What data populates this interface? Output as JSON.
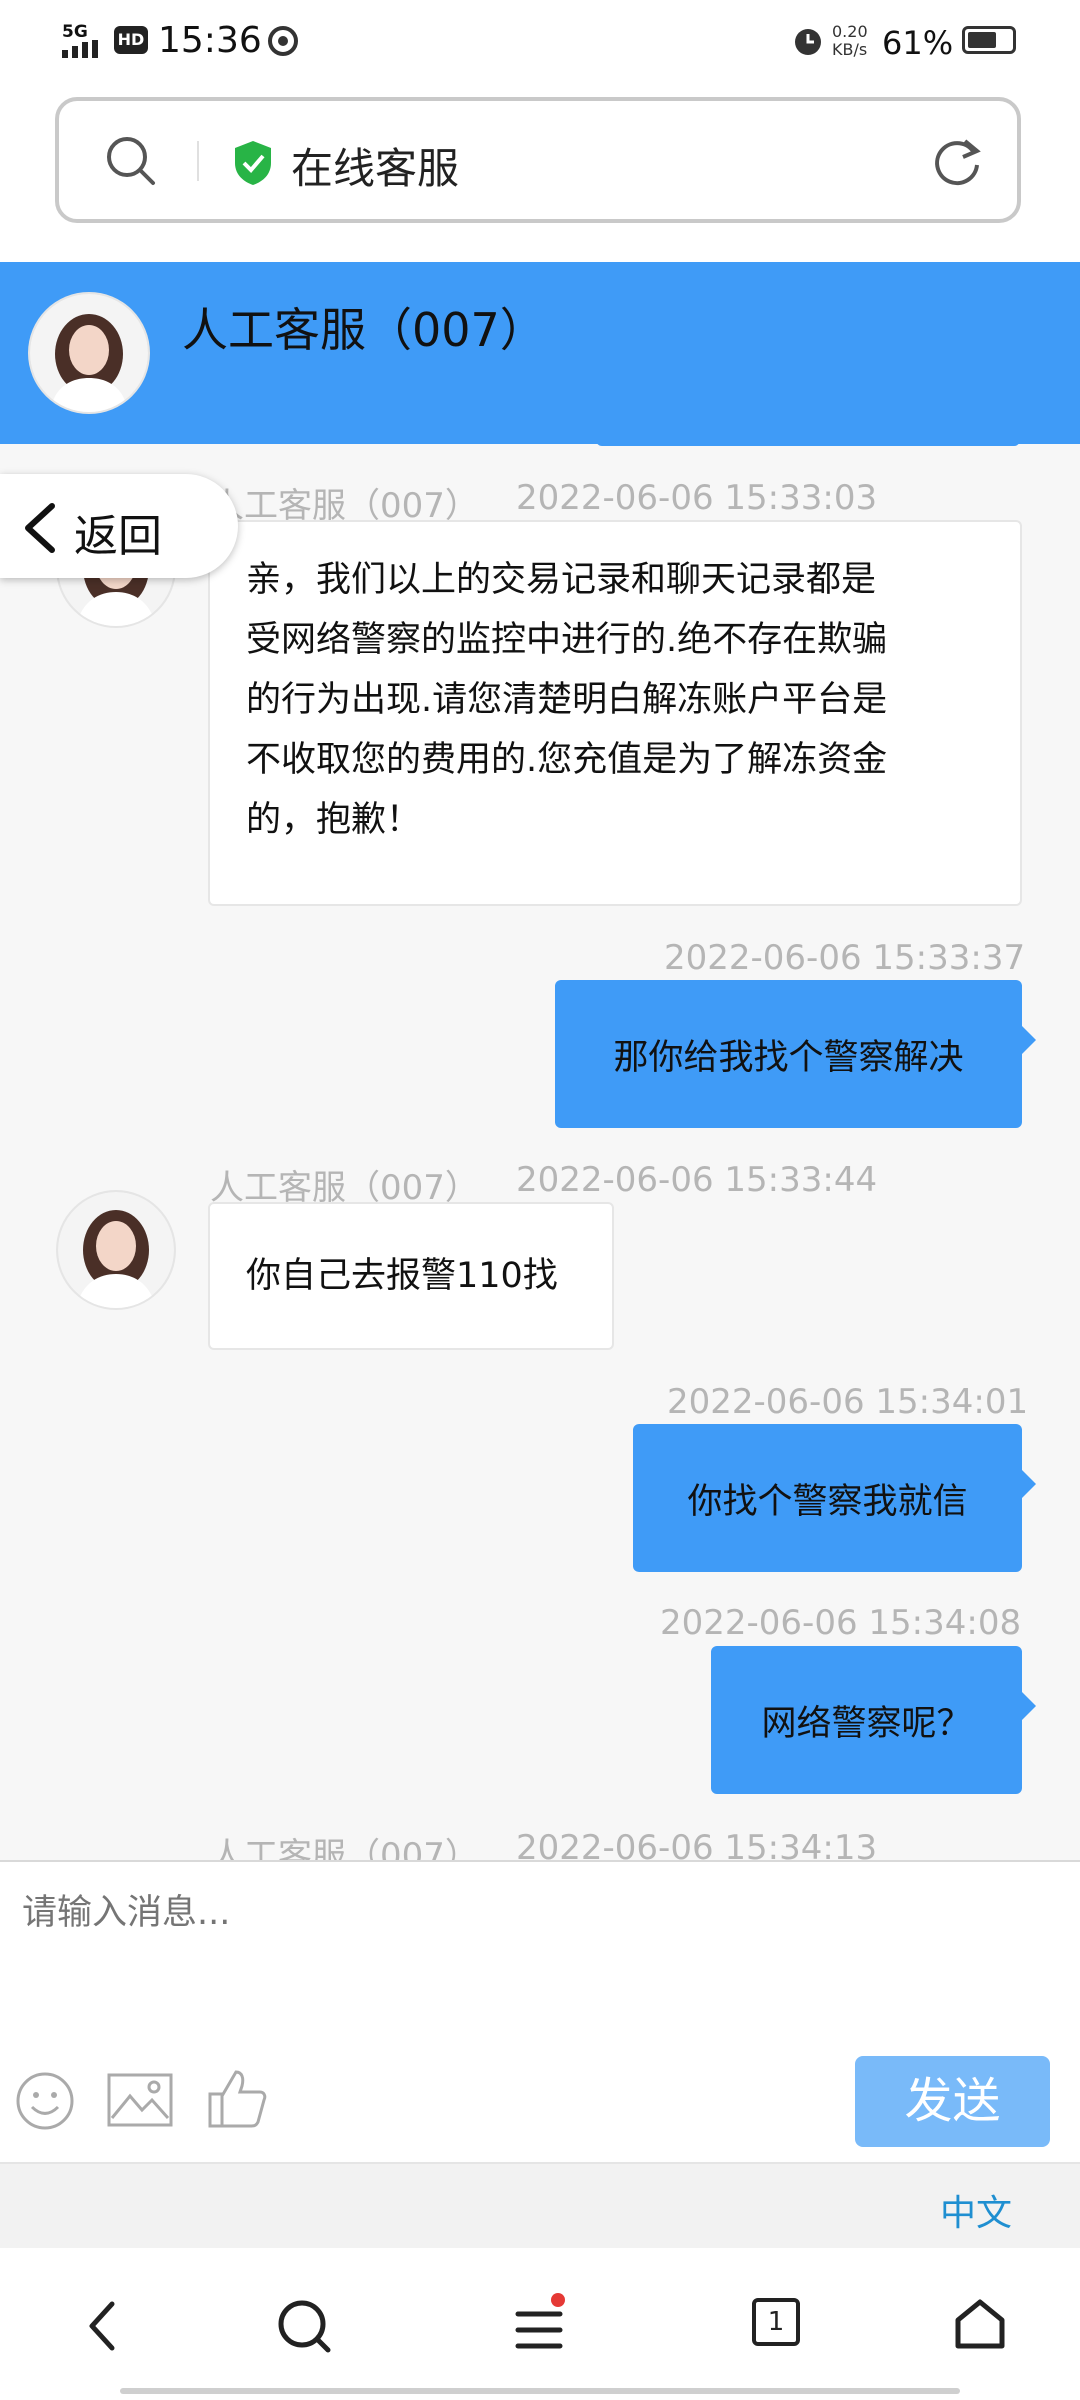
{
  "status_bar": {
    "network": "5G",
    "hd": "HD",
    "time": "15:36",
    "speed_value": "0.20",
    "speed_unit": "KB/s",
    "battery": "61%"
  },
  "browser": {
    "title": "在线客服"
  },
  "header": {
    "agent_name": "人工客服（007）"
  },
  "back_label": "返回",
  "messages": [
    {
      "sender": "人工客服（007）",
      "time": "2022-06-06 15:33:03",
      "lines": [
        "亲，我们以上的交易记录和聊天记录都是",
        "受网络警察的监控中进行的.绝不存在欺骗",
        "的行为出现.请您清楚明白解冻账户平台是",
        "不收取您的费用的.您充值是为了解冻资金",
        "的，抱歉！"
      ]
    },
    {
      "time": "2022-06-06 15:33:37",
      "text": "那你给我找个警察解决"
    },
    {
      "sender": "人工客服（007）",
      "time": "2022-06-06 15:33:44",
      "text": "你自己去报警110找"
    },
    {
      "time": "2022-06-06 15:34:01",
      "text": "你找个警察我就信"
    },
    {
      "time": "2022-06-06 15:34:08",
      "text": "网络警察呢？"
    },
    {
      "sender": "人工客服（007）",
      "time": "2022-06-06 15:34:13"
    }
  ],
  "input": {
    "placeholder": "请输入消息..."
  },
  "send_label": "发送",
  "language_label": "中文",
  "nav": {
    "tab_count": "1"
  }
}
